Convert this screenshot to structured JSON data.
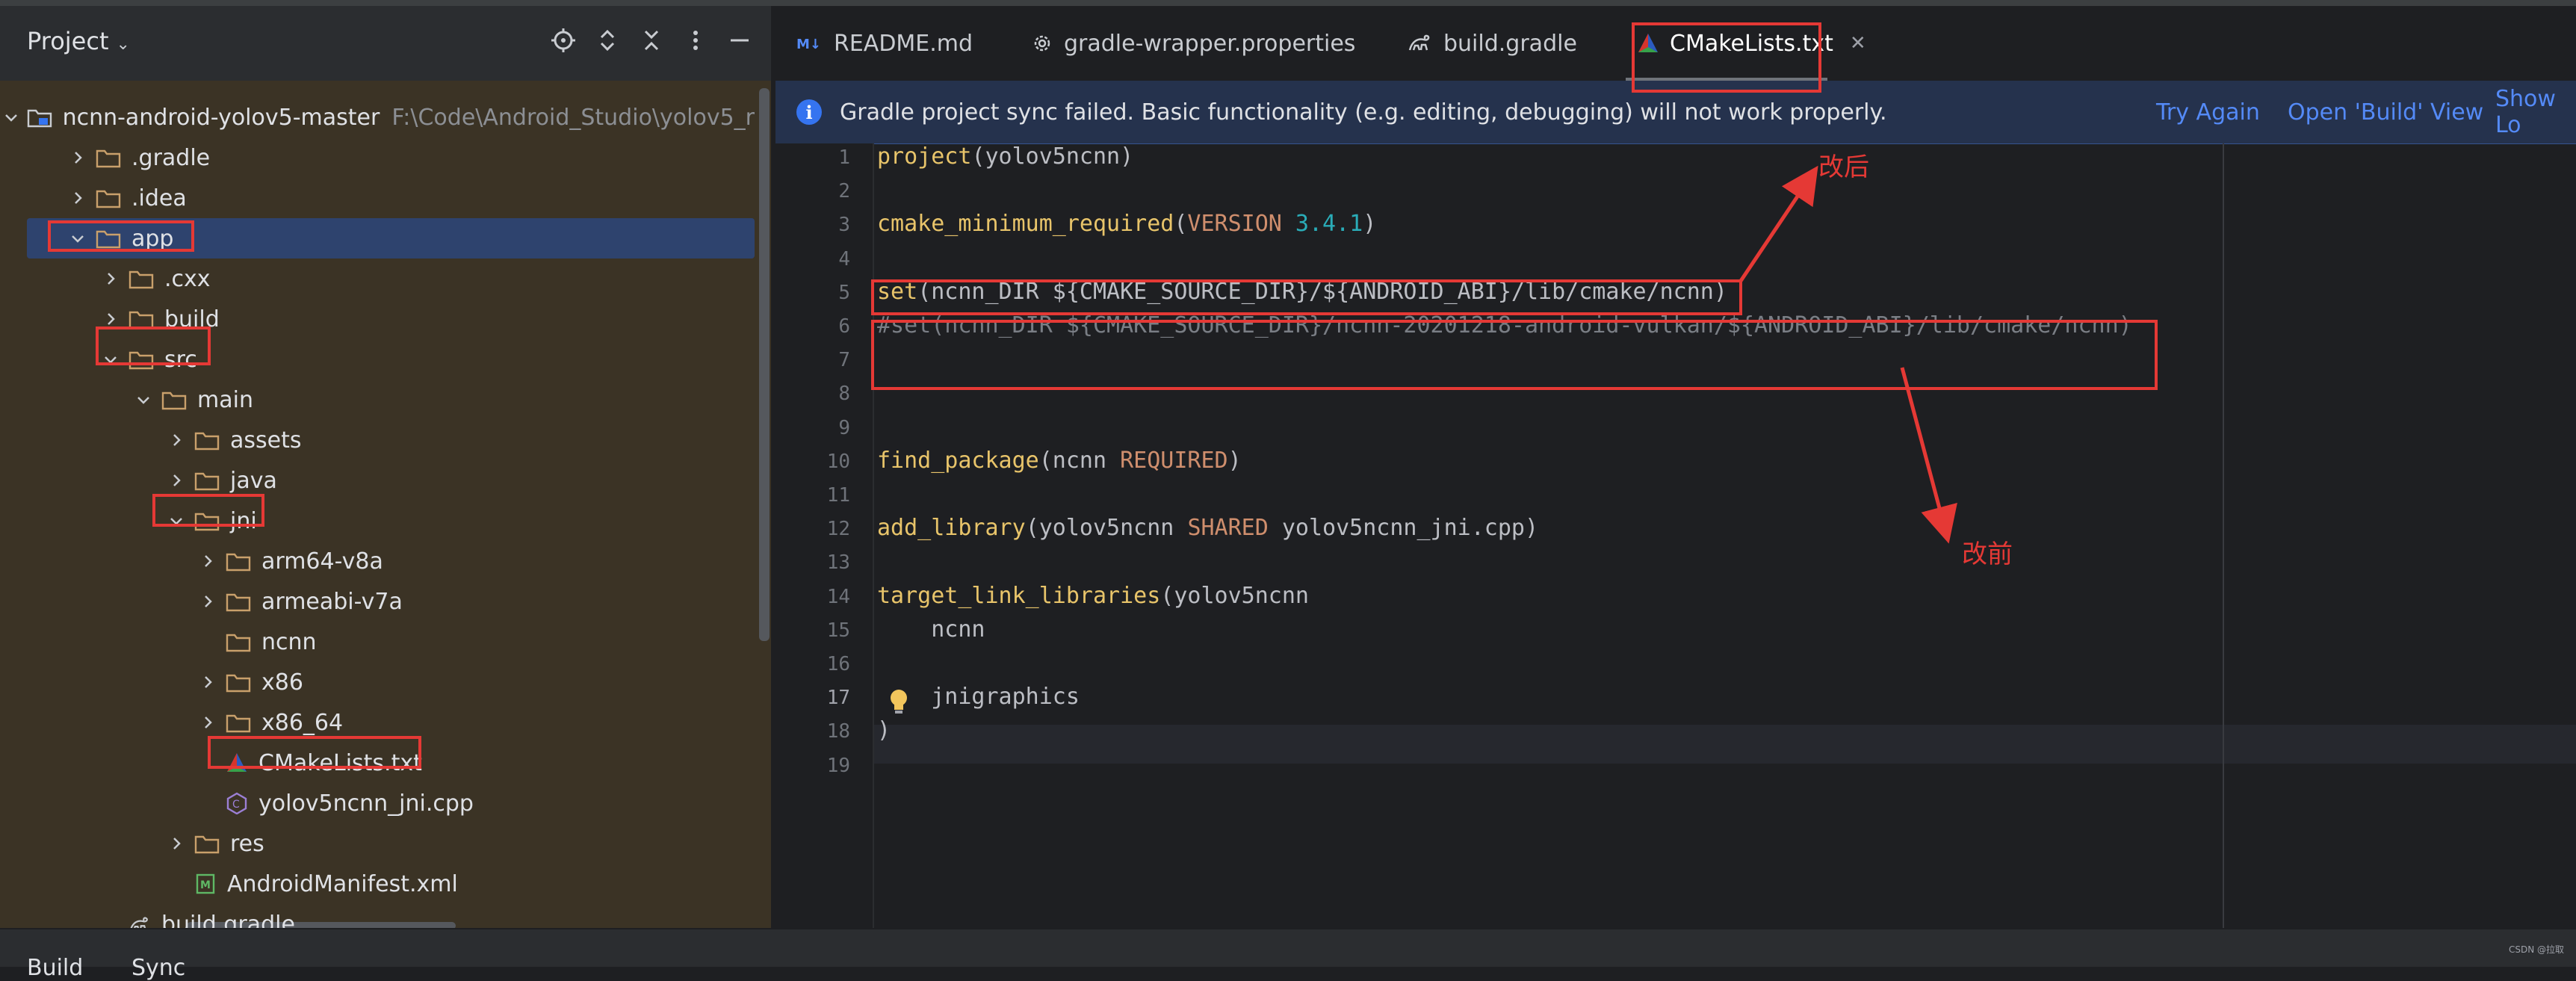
{
  "project_panel": {
    "title": "Project",
    "tree": [
      {
        "label": "ncnn-android-yolov5-master",
        "hint": "F:\\Code\\Android_Studio\\yolov5_r"
      },
      {
        "label": ".gradle"
      },
      {
        "label": ".idea"
      },
      {
        "label": "app"
      },
      {
        "label": ".cxx"
      },
      {
        "label": "build"
      },
      {
        "label": "src"
      },
      {
        "label": "main"
      },
      {
        "label": "assets"
      },
      {
        "label": "java"
      },
      {
        "label": "jni"
      },
      {
        "label": "arm64-v8a"
      },
      {
        "label": "armeabi-v7a"
      },
      {
        "label": "ncnn"
      },
      {
        "label": "x86"
      },
      {
        "label": "x86_64"
      },
      {
        "label": "CMakeLists.txt"
      },
      {
        "label": "yolov5ncnn_jni.cpp"
      },
      {
        "label": "res"
      },
      {
        "label": "AndroidManifest.xml"
      },
      {
        "label": "build.gradle"
      }
    ]
  },
  "tabs": [
    {
      "label": "README.md",
      "icon": "markdown-icon"
    },
    {
      "label": "gradle-wrapper.properties",
      "icon": "gear-icon"
    },
    {
      "label": "build.gradle",
      "icon": "gradle-icon"
    },
    {
      "label": "CMakeLists.txt",
      "icon": "cmake-icon",
      "active": true
    }
  ],
  "banner": {
    "message": "Gradle project sync failed. Basic functionality (e.g. editing, debugging) will not work properly.",
    "try_again": "Try Again",
    "open_build": "Open 'Build' View",
    "show_log": "Show Lo"
  },
  "editor": {
    "current_line": 17,
    "lines": [
      "project(yolov5ncnn)",
      "",
      "cmake_minimum_required(VERSION 3.4.1)",
      "",
      "set(ncnn_DIR ${CMAKE_SOURCE_DIR}/${ANDROID_ABI}/lib/cmake/ncnn)",
      "#set(ncnn_DIR ${CMAKE_SOURCE_DIR}/ncnn-20201218-android-vulkan/${ANDROID_ABI}/lib/cmake/ncnn)",
      "",
      "",
      "",
      "find_package(ncnn REQUIRED)",
      "",
      "add_library(yolov5ncnn SHARED yolov5ncnn_jni.cpp)",
      "",
      "target_link_libraries(yolov5ncnn",
      "    ncnn",
      "",
      "    jnigraphics",
      ")",
      ""
    ],
    "line_numbers": [
      "1",
      "2",
      "3",
      "4",
      "5",
      "6",
      "7",
      "8",
      "9",
      "10",
      "11",
      "12",
      "13",
      "14",
      "15",
      "16",
      "17",
      "18",
      "19"
    ]
  },
  "annotations": {
    "after": "改后",
    "before": "改前"
  },
  "bottom": {
    "build": "Build",
    "sync": "Sync"
  },
  "watermark": "CSDN @拉取",
  "colors": {
    "accent": "#3574f0",
    "annotation_red": "#e53935",
    "selection": "#2e436e"
  }
}
